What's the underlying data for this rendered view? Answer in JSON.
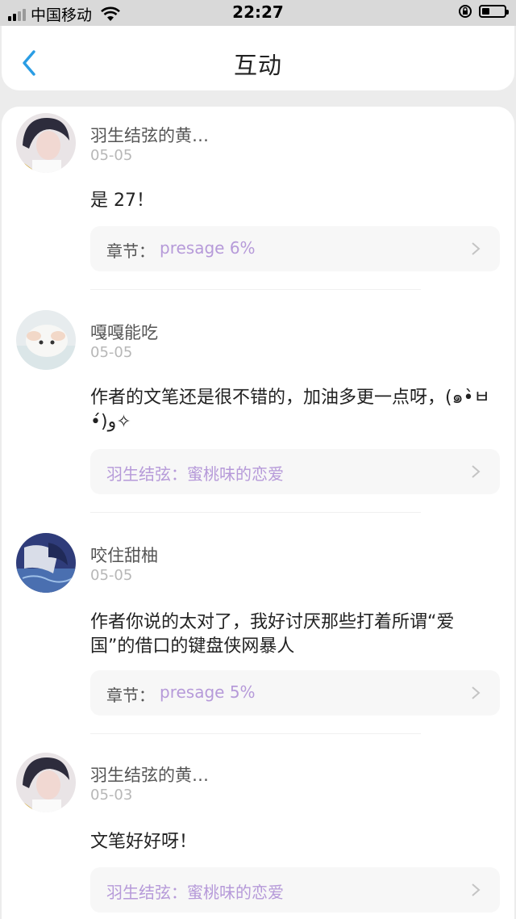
{
  "status_bar": {
    "carrier": "中国移动",
    "time": "22:27"
  },
  "nav": {
    "title": "互动"
  },
  "comments": [
    {
      "username": "羽生结弦的黄…",
      "date": "05-05",
      "text": "是 27！",
      "ref_label": "章节：",
      "ref_value": "presage 6%"
    },
    {
      "username": "嘎嘎能吃",
      "date": "05-05",
      "text": "作者的文笔还是很不错的，加油多更一点呀，(๑•̀ㅂ•́)و✧",
      "ref_label": "",
      "ref_value": "羽生结弦：蜜桃味的恋爱"
    },
    {
      "username": "咬住甜柚",
      "date": "05-05",
      "text": "作者你说的太对了，我好讨厌那些打着所谓“爱国”的借口的键盘侠网暴人",
      "ref_label": "章节：",
      "ref_value": "presage 5%"
    },
    {
      "username": "羽生结弦的黄…",
      "date": "05-03",
      "text": "文笔好好呀！",
      "ref_label": "",
      "ref_value": "羽生结弦：蜜桃味的恋爱"
    }
  ]
}
